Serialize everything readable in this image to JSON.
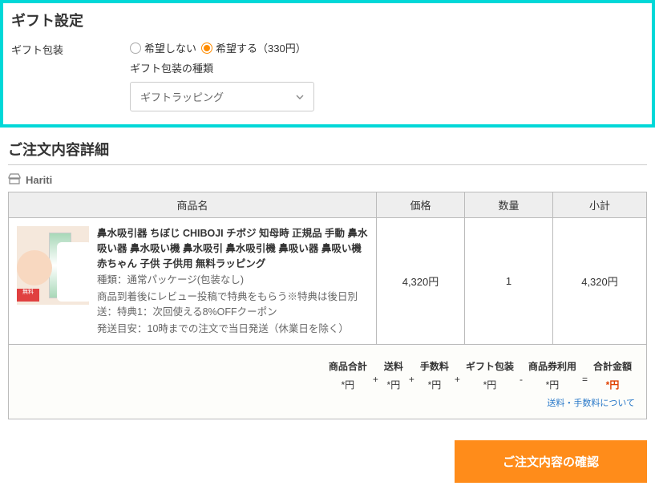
{
  "gift": {
    "title": "ギフト設定",
    "wrapping_label": "ギフト包装",
    "radio_no": "希望しない",
    "radio_yes": "希望する（330円）",
    "type_label": "ギフト包装の種類",
    "select_value": "ギフトラッピング"
  },
  "order": {
    "title": "ご注文内容詳細",
    "shop_name": "Hariti",
    "headers": {
      "name": "商品名",
      "price": "価格",
      "qty": "数量",
      "subtotal": "小計"
    },
    "product": {
      "title": "鼻水吸引器 ちぼじ CHIBOJI チボジ 知母時 正規品 手動 鼻水吸い器 鼻水吸い機 鼻水吸引 鼻水吸引機 鼻吸い器 鼻吸い機 赤ちゃん 子供 子供用 無料ラッピング",
      "variant": "種類：通常パッケージ(包装なし)",
      "note": "商品到着後にレビュー投稿で特典をもらう※特典は後日別送：特典1：次回使える8%OFFクーポン",
      "shipping": "発送目安：10時までの注文で当日発送（休業日を除く）",
      "price": "4,320円",
      "qty": "1",
      "subtotal": "4,320円",
      "ribbon": "無料"
    },
    "summary": {
      "labels": {
        "goods": "商品合計",
        "ship": "送料",
        "fee": "手数料",
        "gift": "ギフト包装",
        "coupon": "商品券利用",
        "total": "合計金額"
      },
      "values": {
        "goods": "*円",
        "ship": "*円",
        "fee": "*円",
        "gift": "*円",
        "coupon": "*円",
        "total": "*円"
      },
      "fee_link": "送料・手数料について"
    },
    "confirm_button": "ご注文内容の確認"
  }
}
